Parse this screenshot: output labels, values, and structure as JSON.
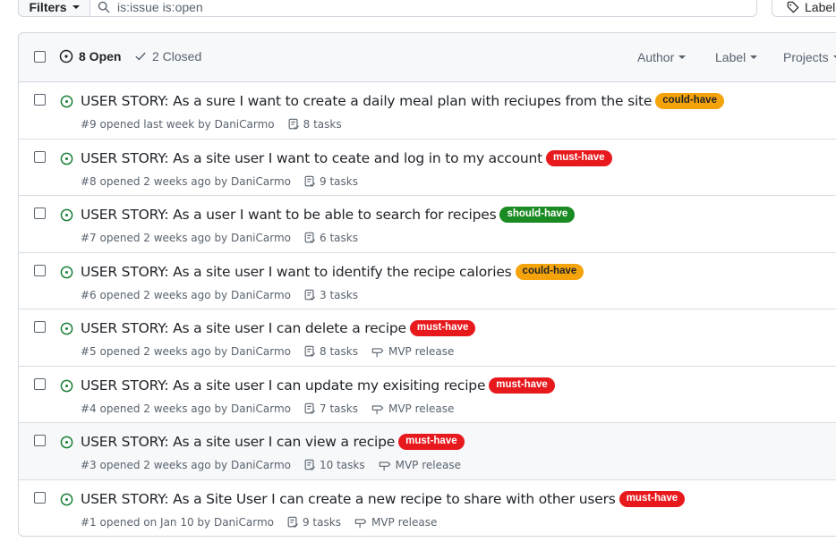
{
  "toolbar": {
    "filters_label": "Filters",
    "search_value": "is:issue is:open",
    "labels_label": "Labels"
  },
  "header": {
    "open_label": "8 Open",
    "closed_label": "2 Closed",
    "author_label": "Author",
    "label_label": "Label",
    "projects_label": "Projects"
  },
  "colors": {
    "open_green": "#1a7f37",
    "could_have": "#f0a30a",
    "must_have": "#e8191d",
    "should_have": "#1a8a22"
  },
  "issues": [
    {
      "title": "USER STORY: As a sure I want to create a daily meal plan with reciupes from the site",
      "label": "could-have",
      "label_bg": "#f5a30b",
      "label_fg": "#1f2328",
      "meta": "#9 opened last week by DaniCarmo",
      "tasks": "8 tasks",
      "milestone": ""
    },
    {
      "title": "USER STORY: As a site user I want to ceate and log in to my account",
      "label": "must-have",
      "label_bg": "#e8191d",
      "label_fg": "#ffffff",
      "meta": "#8 opened 2 weeks ago by DaniCarmo",
      "tasks": "9 tasks",
      "milestone": ""
    },
    {
      "title": "USER STORY: As a user I want to be able to search for recipes",
      "label": "should-have",
      "label_bg": "#1a8a22",
      "label_fg": "#ffffff",
      "meta": "#7 opened 2 weeks ago by DaniCarmo",
      "tasks": "6 tasks",
      "milestone": ""
    },
    {
      "title": "USER STORY: As a site user I want to identify the recipe calories",
      "label": "could-have",
      "label_bg": "#f5a30b",
      "label_fg": "#1f2328",
      "meta": "#6 opened 2 weeks ago by DaniCarmo",
      "tasks": "3 tasks",
      "milestone": ""
    },
    {
      "title": "USER STORY: As a site user I can delete a recipe",
      "label": "must-have",
      "label_bg": "#e8191d",
      "label_fg": "#ffffff",
      "meta": "#5 opened 2 weeks ago by DaniCarmo",
      "tasks": "8 tasks",
      "milestone": "MVP release"
    },
    {
      "title": "USER STORY: As a site user I can update my exisiting recipe",
      "label": "must-have",
      "label_bg": "#e8191d",
      "label_fg": "#ffffff",
      "meta": "#4 opened 2 weeks ago by DaniCarmo",
      "tasks": "7 tasks",
      "milestone": "MVP release"
    },
    {
      "title": "USER STORY: As a site user I can view a recipe",
      "label": "must-have",
      "label_bg": "#e8191d",
      "label_fg": "#ffffff",
      "meta": "#3 opened 2 weeks ago by DaniCarmo",
      "tasks": "10 tasks",
      "milestone": "MVP release"
    },
    {
      "title": "USER STORY: As a Site User I can create a new recipe to share with other users",
      "label": "must-have",
      "label_bg": "#e8191d",
      "label_fg": "#ffffff",
      "meta": "#1 opened on Jan 10 by DaniCarmo",
      "tasks": "9 tasks",
      "milestone": "MVP release"
    }
  ]
}
